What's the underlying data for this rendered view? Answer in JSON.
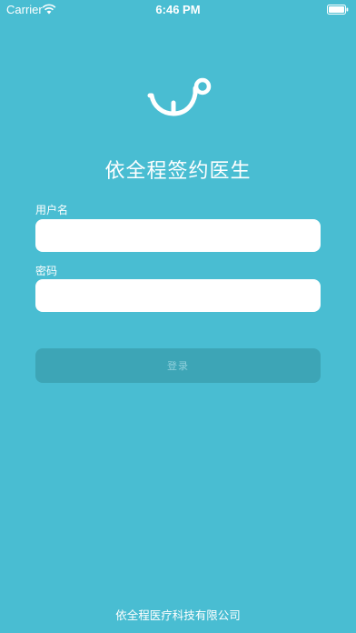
{
  "status_bar": {
    "carrier": "Carrier",
    "time": "6:46 PM",
    "wifi_icon": "wifi-icon",
    "battery_icon": "battery-icon"
  },
  "logo": {
    "icon": "stethoscope-logo-icon"
  },
  "app_title": "依全程签约医生",
  "form": {
    "username_label": "用户名",
    "username_value": "",
    "password_label": "密码",
    "password_value": "",
    "login_label": "登录"
  },
  "footer": "依全程医疗科技有限公司",
  "colors": {
    "background": "#49BDD2",
    "button": "#3DA5B6",
    "button_text": "#8FD0DC"
  }
}
